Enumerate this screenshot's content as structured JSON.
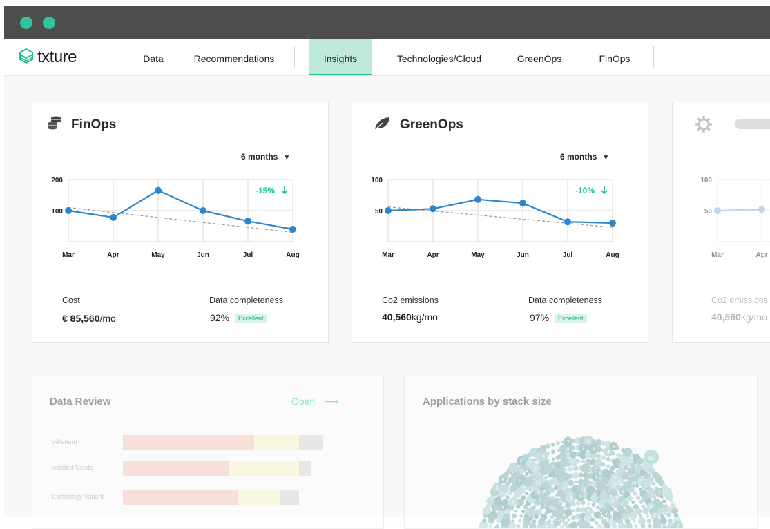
{
  "brand": {
    "name": "txture"
  },
  "nav": {
    "items": [
      {
        "label": "Data"
      },
      {
        "label": "Recommendations"
      },
      {
        "label": "Insights"
      },
      {
        "label": "Technologies/Cloud"
      },
      {
        "label": "GreenOps"
      },
      {
        "label": "FinOps"
      }
    ],
    "active": "Insights"
  },
  "colors": {
    "accent": "#1fbf8f",
    "line": "#2e86c8",
    "trend": "#9a9a9a",
    "bar_red": "#f8c5b6",
    "bar_yellow": "#f8f6c3",
    "bar_gray": "#d3d3d3"
  },
  "finops": {
    "title": "FinOps",
    "icon": "coins-icon",
    "range": "6 months",
    "delta": "-15%",
    "metric_label": "Cost",
    "metric_value_bold": "€ 85,560",
    "metric_unit": "/mo",
    "completeness_label": "Data completeness",
    "completeness_value": "92%",
    "completeness_badge": "Excellent"
  },
  "greenops": {
    "title": "GreenOps",
    "icon": "leaf-icon",
    "range": "6 months",
    "delta": "-10%",
    "metric_label": "Co2 emissions",
    "metric_value_bold": "40,560",
    "metric_unit": "kg/mo",
    "completeness_label": "Data completeness",
    "completeness_value": "97%",
    "completeness_badge": "Excellent"
  },
  "third": {
    "icon": "gear-icon",
    "metric_label": "Co2 emissions",
    "metric_value_bold": "40,560",
    "metric_unit": "kg/mo"
  },
  "data_review": {
    "title": "Data Review",
    "open_label": "Open",
    "rows": [
      {
        "label": "V-Pattern",
        "red": 0.56,
        "yellow": 0.19,
        "gray": 0.1
      },
      {
        "label": "Isolated Assets",
        "red": 0.45,
        "yellow": 0.3,
        "gray": 0.05
      },
      {
        "label": "Technology Variant",
        "red": 0.49,
        "yellow": 0.18,
        "gray": 0.08
      }
    ]
  },
  "apps": {
    "title": "Applications by stack size",
    "bubble_labels": [
      "15",
      "6",
      "5",
      "8",
      "2",
      "3",
      "4",
      "9",
      "7",
      "1"
    ]
  },
  "chart_data": [
    {
      "type": "line",
      "title": "FinOps",
      "categories": [
        "Mar",
        "Apr",
        "May",
        "Jun",
        "Jul",
        "Aug"
      ],
      "series": [
        {
          "values": [
            100,
            78,
            165,
            100,
            66,
            40
          ]
        }
      ],
      "trend": [
        110,
        30
      ],
      "yticks": [
        100,
        200
      ],
      "ylim": [
        0,
        200
      ],
      "grid": true,
      "annotation": "-15%"
    },
    {
      "type": "line",
      "title": "GreenOps",
      "categories": [
        "Mar",
        "Apr",
        "May",
        "Jun",
        "Jul",
        "Aug"
      ],
      "series": [
        {
          "values": [
            50,
            53,
            68,
            62,
            32,
            30
          ]
        }
      ],
      "trend": [
        56,
        23
      ],
      "yticks": [
        50,
        100
      ],
      "ylim": [
        0,
        100
      ],
      "grid": true,
      "annotation": "-10%"
    },
    {
      "type": "line",
      "categories": [
        "Mar",
        "Apr"
      ],
      "series": [
        {
          "values": [
            50,
            52
          ]
        }
      ],
      "yticks": [
        50,
        100
      ],
      "ylim": [
        0,
        100
      ],
      "grid": true
    }
  ]
}
